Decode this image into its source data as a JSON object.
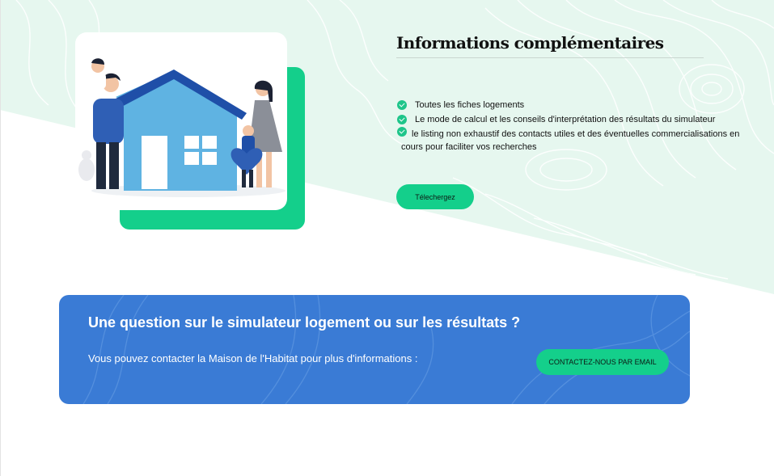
{
  "info": {
    "title": "Informations complémentaires",
    "items": [
      "Toutes les fiches logements",
      "Le mode de calcul et les conseils d'interprétation des résultats du simulateur",
      "le listing non exhaustif des contacts utiles et des éventuelles commercialisations en",
      "cours pour faciliter vos recherches"
    ],
    "download_label": "Télechergez"
  },
  "contact": {
    "title": "Une question sur le simulateur logement ou sur les résultats ?",
    "text": "Vous pouvez contacter la Maison de l'Habitat pour plus d'informations :",
    "button_label": "CONTACTEZ-NOUS PAR EMAIL"
  },
  "colors": {
    "mint_background": "#e6f7ef",
    "accent_green": "#14cf8b",
    "banner_blue": "#3a7bd5",
    "house_blue": "#5fb3e2",
    "roof_navy": "#1f4fa8"
  },
  "icons": [
    "check-icon",
    "family-house-illustration"
  ]
}
